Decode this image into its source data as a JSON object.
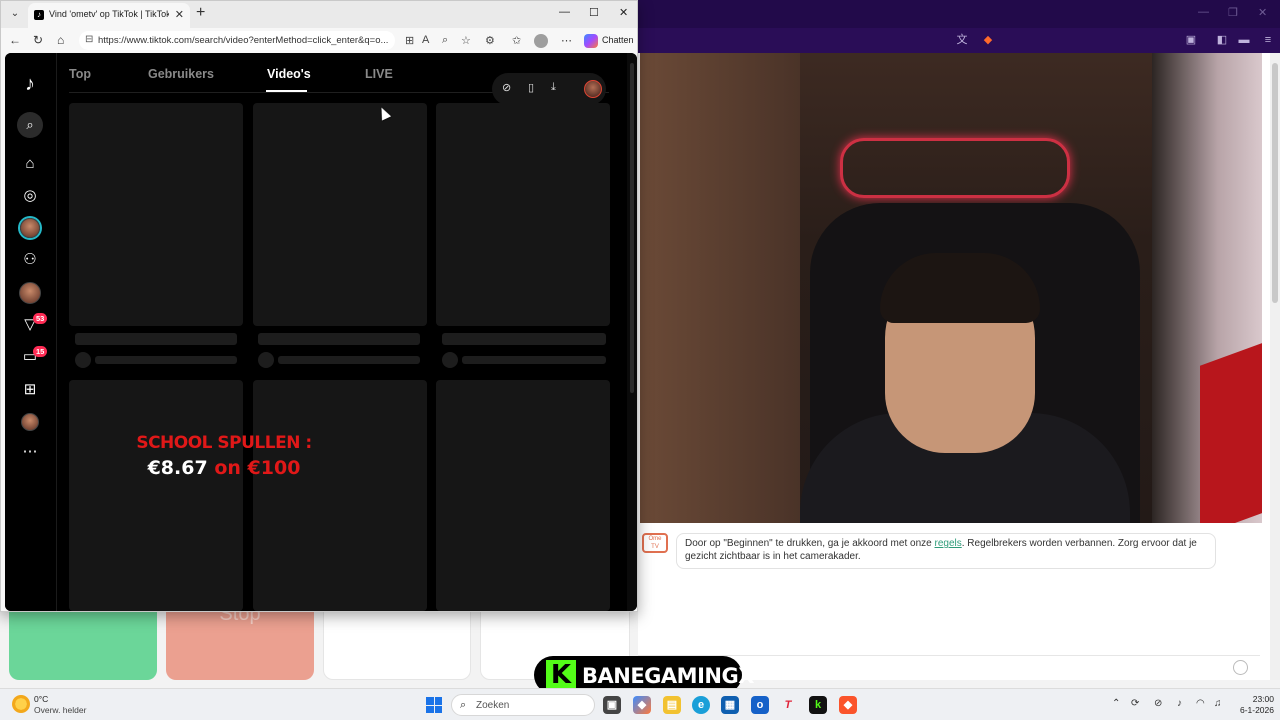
{
  "front_browser": {
    "tab_title": "Vind 'ometv' op TikTok | TikTok zo",
    "url": "https://www.tiktok.com/search/video?enterMethod=click_enter&q=o...",
    "copilot_label": "Chatten",
    "tabs": [
      "Top",
      "Gebruikers",
      "Video's",
      "LIVE"
    ],
    "active_tab": "Video's",
    "badges": {
      "inbox": "53",
      "messages": "15"
    },
    "video_overlay": {
      "line1": "SCHOOL SPULLEN :",
      "amount": "€8.67",
      "connector": "on",
      "total": "€100"
    }
  },
  "back_browser": {
    "rules_text_before": "Door op \"Beginnen\" te drukken, ga je akkoord met onze ",
    "rules_link": "regels",
    "rules_text_after": ". Regelbrekers worden verbannen. Zorg ervoor dat je gezicht zichtbaar is in het camerakader.",
    "ome_logo": "Ome TV",
    "stop_label": "Stop"
  },
  "kick_banner": {
    "letter": "K",
    "channel": "BANEGAMINGX",
    "brand_color": "#53fc18"
  },
  "taskbar": {
    "weather_temp": "0°C",
    "weather_cond": "Overw. helder",
    "search_placeholder": "Zoeken",
    "time": "23:00",
    "date": "6-1-2026"
  },
  "colors": {
    "tiktok_bg": "#000000",
    "tiktok_badge": "#fe2c55",
    "back_chrome": "#2a0d57",
    "start_green": "#6bd699",
    "stop_red": "#eba090"
  }
}
